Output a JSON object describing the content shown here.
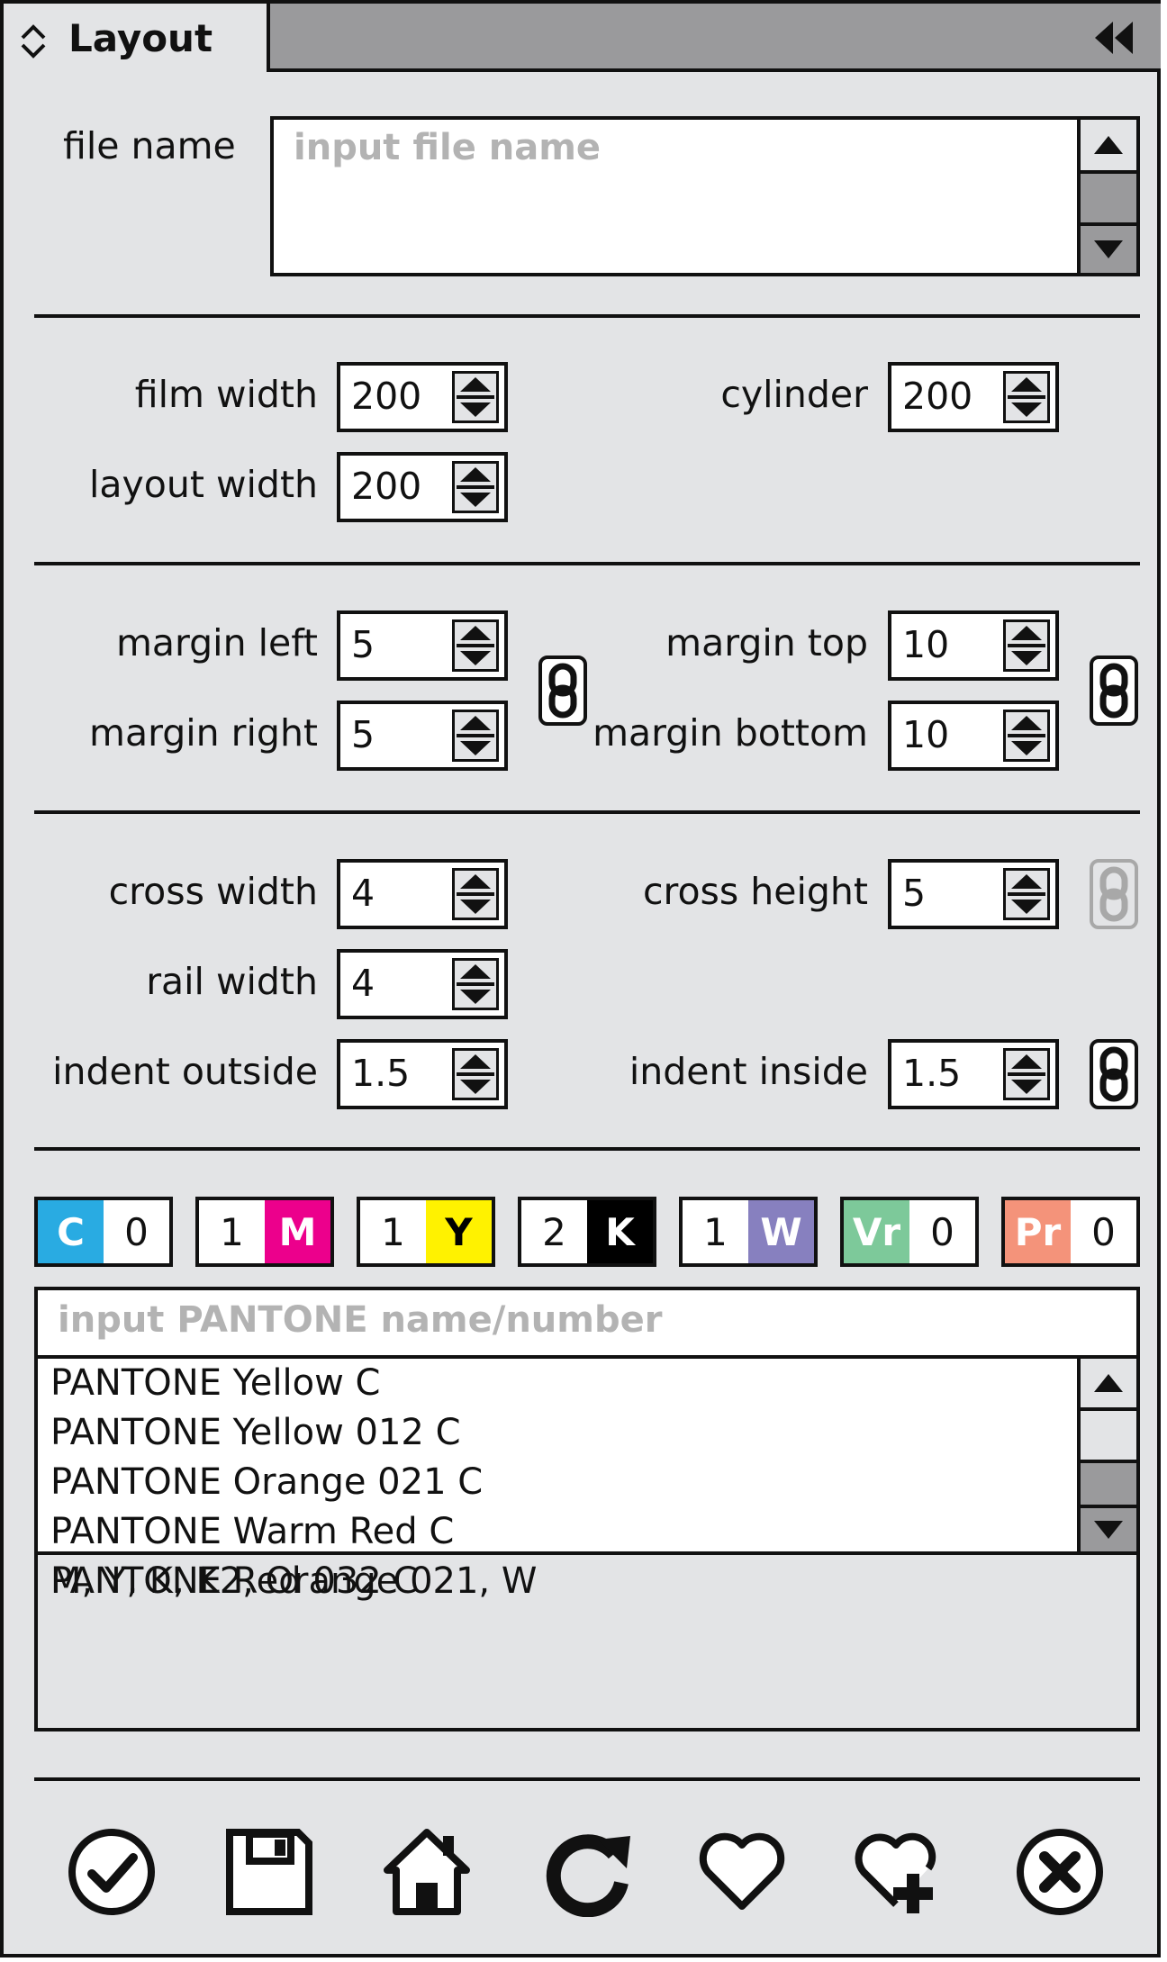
{
  "header": {
    "title": "Layout",
    "collapse_icon": "chevrons-left-icon",
    "sort_icon": "updown-chevron-icon"
  },
  "file": {
    "label": "file name",
    "placeholder": "input file name"
  },
  "dimensions": {
    "film_width": {
      "label": "film width",
      "value": "200"
    },
    "layout_width": {
      "label": "layout width",
      "value": "200"
    },
    "cylinder": {
      "label": "cylinder",
      "value": "200"
    }
  },
  "margins": {
    "left": {
      "label": "margin left",
      "value": "5"
    },
    "right": {
      "label": "margin right",
      "value": "5"
    },
    "top": {
      "label": "margin top",
      "value": "10"
    },
    "bottom": {
      "label": "margin bottom",
      "value": "10"
    }
  },
  "crosses": {
    "cross_width": {
      "label": "cross width",
      "value": "4"
    },
    "rail_width": {
      "label": "rail width",
      "value": "4"
    },
    "indent_outside": {
      "label": "indent outside",
      "value": "1.5"
    },
    "cross_height": {
      "label": "cross height",
      "value": "5"
    },
    "indent_inside": {
      "label": "indent inside",
      "value": "1.5"
    }
  },
  "inks": [
    {
      "letter": "C",
      "count": "0",
      "color": "#29abe2",
      "ink_side": "left"
    },
    {
      "letter": "M",
      "count": "1",
      "color": "#ec008c",
      "ink_side": "right"
    },
    {
      "letter": "Y",
      "count": "1",
      "color": "#fff200",
      "ink_side": "right"
    },
    {
      "letter": "K",
      "count": "2",
      "color": "#000000",
      "ink_side": "right"
    },
    {
      "letter": "W",
      "count": "1",
      "color": "#8780bf",
      "ink_side": "right"
    },
    {
      "letter": "Vr",
      "count": "0",
      "color": "#7dc99a",
      "ink_side": "left"
    },
    {
      "letter": "Pr",
      "count": "0",
      "color": "#f4937a",
      "ink_side": "left"
    }
  ],
  "pantone": {
    "placeholder": "input PANTONE name/number",
    "items": [
      "PANTONE Yellow C",
      "PANTONE Yellow 012 C",
      "PANTONE Orange 021 C",
      "PANTONE Warm Red C",
      "PANTONE Red 032 C"
    ],
    "selected_summary": "M, Y, K, K2, Orange 021, W"
  },
  "actions": [
    "check-circle-icon",
    "save-icon",
    "home-icon",
    "refresh-icon",
    "heart-icon",
    "heart-plus-icon",
    "close-circle-icon"
  ]
}
